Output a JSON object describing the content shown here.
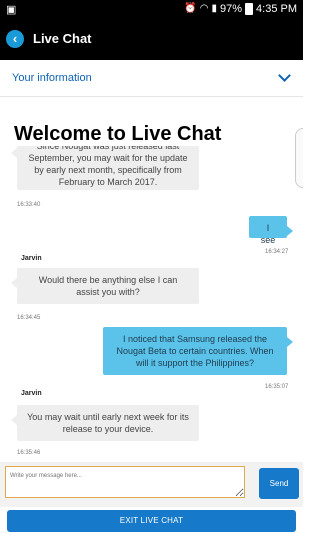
{
  "status_bar": {
    "left_icon": "notification-icon",
    "battery_text": "97%",
    "time": "4:35 PM"
  },
  "app_bar": {
    "title": "Live Chat",
    "back_icon": "back-arrow-icon"
  },
  "info_bar": {
    "label": "Your information",
    "chevron": "chevron-down-icon"
  },
  "chat": {
    "welcome": "Welcome to Live Chat",
    "messages": [
      {
        "from": "agent",
        "text": "Since Nougat was just released last September, you may wait for the update by early next month, specifically from February to March 2017.",
        "time": "16:33:40"
      },
      {
        "from": "user",
        "text": "I see",
        "time": "16:34:27"
      },
      {
        "from": "agent",
        "sender": "Jarvin",
        "text": "Would there be anything else I can assist you with?",
        "time": "16:34:45"
      },
      {
        "from": "user",
        "text": "I noticed that Samsung released the Nougat Beta to certain countries. When will it support the Philippines?",
        "time": "16:35:07"
      },
      {
        "from": "agent",
        "sender": "Jarvin",
        "text": "You may wait until early next week for its release to your device.",
        "time": "16:35:46"
      }
    ]
  },
  "composer": {
    "placeholder": "Write your message here...",
    "send_label": "Send"
  },
  "exit_label": "EXIT LIVE CHAT"
}
